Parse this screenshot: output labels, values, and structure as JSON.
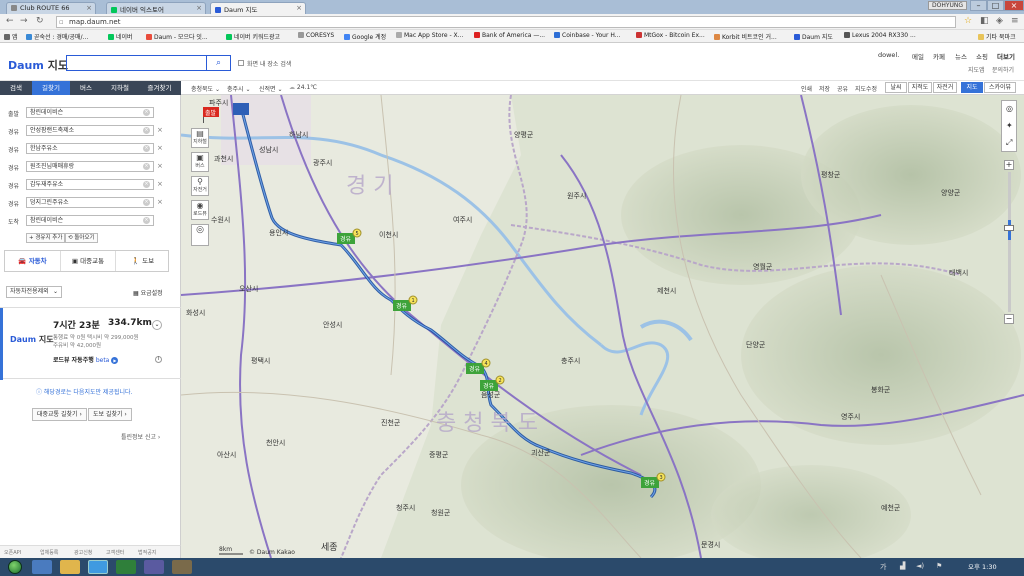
{
  "browser": {
    "tabs": [
      {
        "title": "Club ROUTE 66",
        "active": false,
        "icon_color": "#888888"
      },
      {
        "title": "네이버 익스토어",
        "active": false,
        "icon_color": "#03c75a"
      },
      {
        "title": "Daum 지도",
        "active": true,
        "icon_color": "#2a5bd7"
      }
    ],
    "user": "DOHYUNG",
    "url": "map.daum.net",
    "bookmarks": [
      "앱",
      "곧숙선 : 경매/공매/...",
      "네이버",
      "Daum - 모으다 잇...",
      "네이버 키워드광고",
      "CORESYS",
      "Google 계정",
      "Mac App Store - X...",
      "Bank of America —...",
      "Coinbase - Your H...",
      "MtGox - Bitcoin Ex...",
      "Korbit 비트코인 거...",
      "Daum 지도",
      "Lexus 2004 RX330 ..."
    ],
    "other_bookmarks": "기타 북마크"
  },
  "header": {
    "logo_a": "Daum",
    "logo_b": "지도",
    "search_value": "",
    "chk_label": "화면 내 장소 검색",
    "top_links": [
      "dowel.",
      "메일",
      "카페",
      "뉴스",
      "쇼핑",
      "더보기"
    ],
    "sub_links": [
      "지도앱",
      "문의하기"
    ]
  },
  "nav_tabs": [
    "검색",
    "길찾기",
    "버스",
    "지하철",
    "즐겨찾기"
  ],
  "waypoints": [
    {
      "label": "출발",
      "value": "참린데이비슨",
      "removable": false
    },
    {
      "label": "경유",
      "value": "안성팜랜드축제소",
      "removable": true
    },
    {
      "label": "경유",
      "value": "한남주유소",
      "removable": true
    },
    {
      "label": "경유",
      "value": "원조진님매매휴랑",
      "removable": true
    },
    {
      "label": "경유",
      "value": "감두재주유소",
      "removable": true
    },
    {
      "label": "경유",
      "value": "덩지그린주유소",
      "removable": true
    },
    {
      "label": "도착",
      "value": "참린데이비슨",
      "removable": false
    }
  ],
  "add_waypoint": "+ 경유지 추가",
  "return_trip": "⟲ 돌아오기",
  "modes": [
    "자동차",
    "대중교통",
    "도보"
  ],
  "route_option": "자동차전용제외",
  "fare_label": "요금설정",
  "result": {
    "logo_a": "Daum",
    "logo_b": "지도",
    "time": "7시간 23분",
    "distance": "334.7km",
    "info_1": "통행료 약 0원   택시비 약 299,000원",
    "info_2": "주유비 약 42,000원",
    "roadview": "로드뷰 자동주행",
    "beta": "beta"
  },
  "notice": "ⓘ 해당경로는 다음지도만 제공됩니다.",
  "transit_btn": "대중교통 길찾기 ›",
  "walk_btn": "도보 길찾기 ›",
  "report": "틀린정보 신고 ›",
  "footer_links": [
    "오픈API",
    "업체등록",
    "광고신청",
    "고객센터",
    "법적공지"
  ],
  "map_toolbar": {
    "region": [
      "충청북도",
      "충주시",
      "신적면"
    ],
    "weather": "24.1℃",
    "right_items": [
      "인쇄",
      "저장",
      "공유",
      "지도수정"
    ],
    "buttons": [
      "날씨",
      "지적도",
      "자전거"
    ],
    "view_modes": [
      "지도",
      "스카이뷰"
    ]
  },
  "map": {
    "region_labels": [
      "경 기",
      "충 청 북 도"
    ],
    "cities": [
      "파주시",
      "과천시",
      "성남시",
      "광주시",
      "하남시",
      "이천시",
      "여주시",
      "수원시",
      "용인시",
      "오산시",
      "안성시",
      "평택시",
      "천안시",
      "아산시",
      "음성군",
      "진천군",
      "증평군",
      "청주시",
      "충주시",
      "제천시",
      "괴산군",
      "원주시",
      "영월군",
      "단양군",
      "예천군",
      "문경시",
      "세종",
      "양평군",
      "평창군",
      "영주시",
      "봉화군",
      "태백시",
      "화성시",
      "청원군",
      "양양군"
    ],
    "markers": [
      {
        "label": "경유",
        "num": "5"
      },
      {
        "label": "경유",
        "num": "1"
      },
      {
        "label": "경유",
        "num": "4"
      },
      {
        "label": "경유",
        "num": "2"
      },
      {
        "label": "경유",
        "num": "3"
      }
    ],
    "start_flag": "출발",
    "scale": "8km",
    "copyright": "© Daum Kakao",
    "left_controls": [
      "지하철",
      "버스",
      "자전거",
      "로드뷰"
    ]
  },
  "taskbar": {
    "clock": "오후 1:30",
    "lang": "가"
  }
}
